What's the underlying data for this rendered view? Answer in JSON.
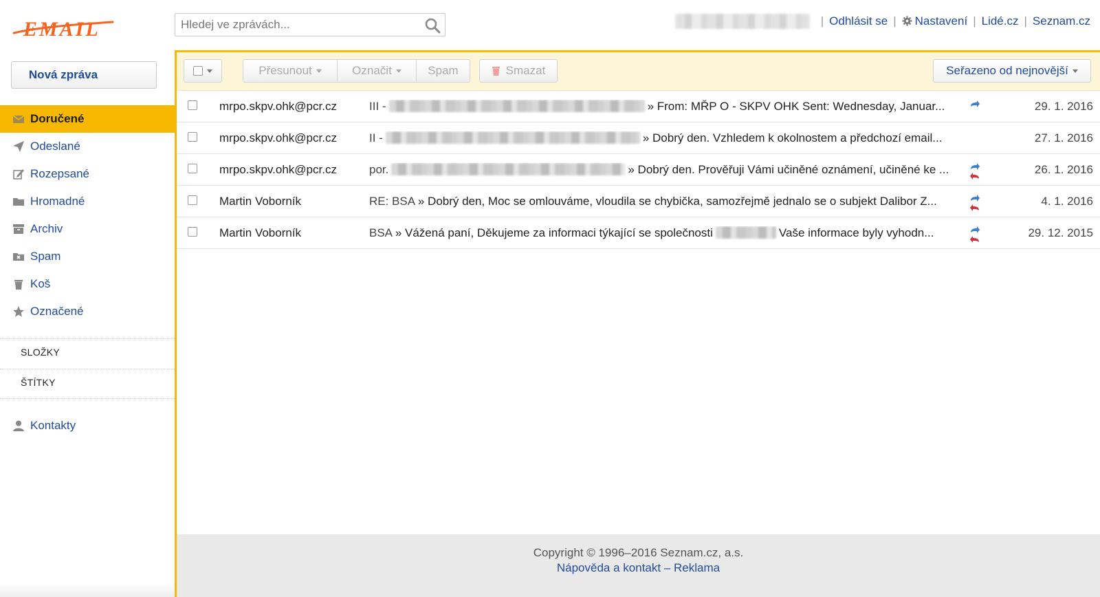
{
  "header": {
    "logo_text": "EMAIL",
    "search_placeholder": "Hledej ve zprávách...",
    "links": {
      "logout": "Odhlásit se",
      "settings": "Nastavení",
      "lide": "Lidé.cz",
      "seznam": "Seznam.cz"
    }
  },
  "sidebar": {
    "new_message": "Nová zpráva",
    "items": [
      {
        "label": "Doručené",
        "icon": "inbox-icon",
        "active": true
      },
      {
        "label": "Odeslané",
        "icon": "paper-plane-icon"
      },
      {
        "label": "Rozepsané",
        "icon": "pencil-icon"
      },
      {
        "label": "Hromadné",
        "icon": "folder-icon"
      },
      {
        "label": "Archiv",
        "icon": "archive-icon"
      },
      {
        "label": "Spam",
        "icon": "spam-folder-icon"
      },
      {
        "label": "Koš",
        "icon": "trash-icon"
      },
      {
        "label": "Označené",
        "icon": "star-icon"
      }
    ],
    "sections": {
      "folders": "SLOŽKY",
      "labels": "ŠTÍTKY"
    },
    "contacts": "Kontakty"
  },
  "toolbar": {
    "move": "Přesunout",
    "mark": "Označit",
    "spam": "Spam",
    "delete": "Smazat",
    "sort": "Seřazeno od nejnovější"
  },
  "messages": [
    {
      "sender": "mrpo.skpv.ohk@pcr.cz",
      "subject_prefix": "III -",
      "preview": "» From: MŘP O - SKPV OHK Sent: Wednesday, Januar...",
      "date": "29. 1. 2016",
      "indicator": "forwarded"
    },
    {
      "sender": "mrpo.skpv.ohk@pcr.cz",
      "subject_prefix": "II -",
      "preview": "» Dobrý den. Vzhledem k okolnostem a předchozí email...",
      "date": "27. 1. 2016",
      "indicator": "none"
    },
    {
      "sender": "mrpo.skpv.ohk@pcr.cz",
      "subject_prefix": "por.",
      "preview": "» Dobrý den. Prověřuji Vámi učiněné oznámení, učiněné ke ...",
      "date": "26. 1. 2016",
      "indicator": "forwarded-replied"
    },
    {
      "sender": "Martin Voborník",
      "subject_prefix": "RE: BSA",
      "preview": "» Dobrý den, Moc se omlouváme, vloudila se chybička, samozřejmě jednalo se o subjekt Dalibor Z...",
      "date": "4. 1. 2016",
      "indicator": "forwarded-replied"
    },
    {
      "sender": "Martin Voborník",
      "subject_prefix": "BSA",
      "preview": "» Vážená paní, Děkujeme za informaci týkající se společnosti",
      "preview_tail": "Vaše informace byly vyhodn...",
      "date": "29. 12. 2015",
      "indicator": "forwarded-replied"
    }
  ],
  "footer": {
    "copyright": "Copyright © 1996–2016 Seznam.cz, a.s.",
    "help": "Nápověda a kontakt",
    "dash": "–",
    "ads": "Reklama"
  },
  "colors": {
    "accent": "#f8b700",
    "link": "#1f4b9a",
    "toolbar_bg": "#fdf5d8",
    "logo": "#f26522"
  }
}
